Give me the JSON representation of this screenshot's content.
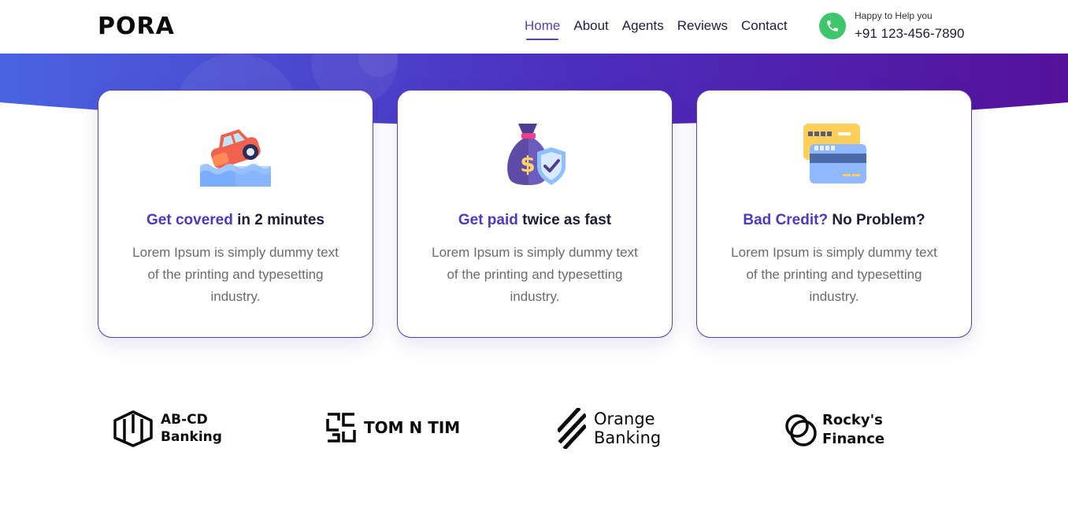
{
  "brand": {
    "logo": "PORA"
  },
  "nav": {
    "items": [
      {
        "label": "Home",
        "active": true
      },
      {
        "label": "About",
        "active": false
      },
      {
        "label": "Agents",
        "active": false
      },
      {
        "label": "Reviews",
        "active": false
      },
      {
        "label": "Contact",
        "active": false
      }
    ]
  },
  "contact": {
    "tagline": "Happy to Help you",
    "phone": "+91 123-456-7890",
    "icon": "phone-icon"
  },
  "colors": {
    "accent": "#5038c0",
    "phone_green": "#3fc66d",
    "band_start": "#4a63e0",
    "band_end": "#55119a"
  },
  "cards": [
    {
      "title_highlight": "Get covered",
      "title_rest": " in 2 minutes",
      "description": "Lorem Ipsum is simply dummy text of the printing and typesetting industry.",
      "icon": "flooded-car-icon"
    },
    {
      "title_highlight": "Get paid",
      "title_rest": " twice as fast",
      "description": "Lorem Ipsum is simply dummy text of the printing and typesetting industry.",
      "icon": "money-bag-shield-icon"
    },
    {
      "title_highlight": "Bad Credit?",
      "title_rest": " No Problem?",
      "description": "Lorem Ipsum is simply dummy text of the printing and typesetting industry.",
      "icon": "credit-cards-icon"
    }
  ],
  "partners": [
    {
      "line1": "AB-CD",
      "line2": "Banking",
      "icon": "abcd-logo-icon"
    },
    {
      "line1": "TOM N TIM",
      "line2": "",
      "icon": "tomntim-logo-icon"
    },
    {
      "line1": "Orange",
      "line2": "Banking",
      "icon": "orange-slashes-logo-icon"
    },
    {
      "line1": "Rocky's",
      "line2": "Finance",
      "icon": "rockys-rings-logo-icon"
    }
  ]
}
